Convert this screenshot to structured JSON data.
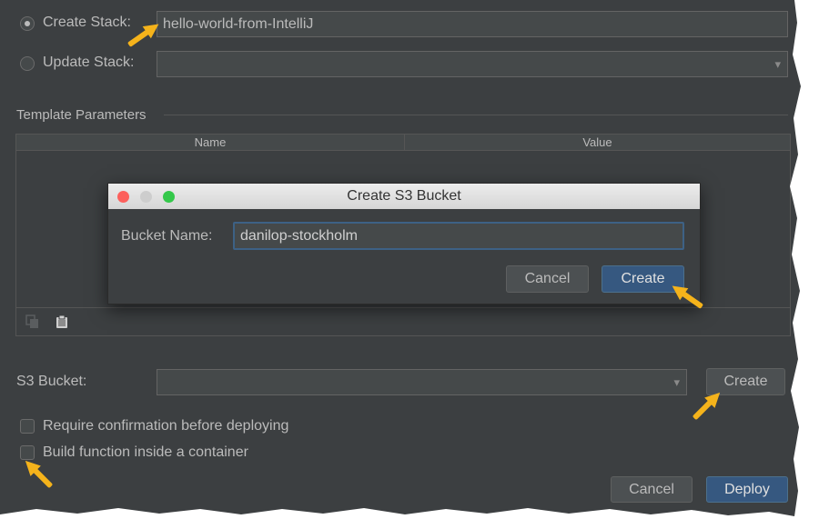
{
  "form": {
    "create_stack_label": "Create Stack:",
    "create_stack_value": "hello-world-from-IntelliJ",
    "update_stack_label": "Update Stack:",
    "template_parameters_label": "Template Parameters",
    "table_headers": [
      "Name",
      "Value"
    ],
    "s3_bucket_label": "S3 Bucket:",
    "s3_create_label": "Create",
    "require_confirmation_label": "Require confirmation before deploying",
    "build_container_label": "Build function inside a container",
    "cancel_label": "Cancel",
    "deploy_label": "Deploy",
    "copy_icon": "copy-icon",
    "paste_icon": "clipboard-icon"
  },
  "dialog": {
    "title": "Create S3 Bucket",
    "bucket_name_label": "Bucket Name:",
    "bucket_name_value": "danilop-stockholm",
    "cancel_label": "Cancel",
    "create_label": "Create"
  },
  "colors": {
    "panel_bg": "#3c3f41",
    "primary_button": "#365880",
    "focus_border": "#3d6185",
    "annotation_arrow": "#f5b31b",
    "traffic_close": "#fc605c",
    "traffic_min": "#cdcdcd",
    "traffic_max": "#34c84a"
  }
}
